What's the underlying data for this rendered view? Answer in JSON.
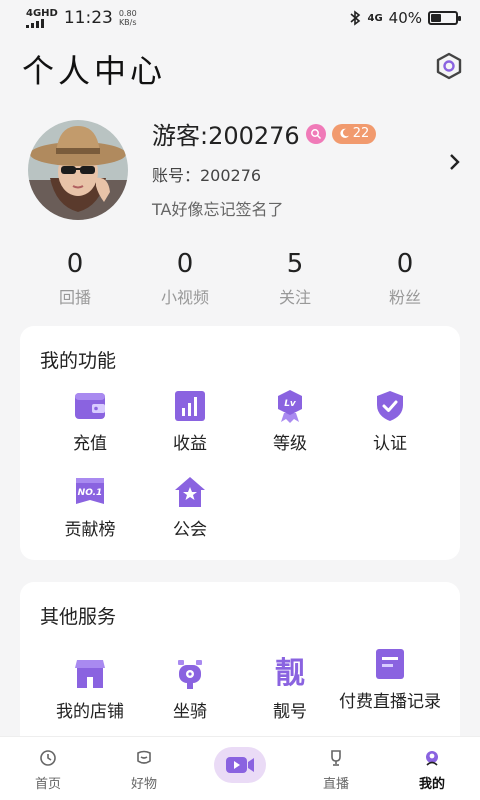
{
  "status_bar": {
    "network": "4GHD",
    "time": "11:23",
    "speed_value": "0.80",
    "speed_unit": "KB/s",
    "network_right": "4G",
    "battery": "40%",
    "battery_level": 0.4
  },
  "header": {
    "title": "个人中心",
    "settings_icon": "hexagon-settings-icon"
  },
  "profile": {
    "name": "游客:200276",
    "level": "22",
    "account": "账号：200276",
    "signature": "TA好像忘记签名了"
  },
  "stats": [
    {
      "value": "0",
      "label": "回播"
    },
    {
      "value": "0",
      "label": "小视频"
    },
    {
      "value": "5",
      "label": "关注"
    },
    {
      "value": "0",
      "label": "粉丝"
    }
  ],
  "functions": {
    "title": "我的功能",
    "items": [
      {
        "label": "充值",
        "icon": "wallet-icon"
      },
      {
        "label": "收益",
        "icon": "income-chart-icon"
      },
      {
        "label": "等级",
        "icon": "level-badge-icon"
      },
      {
        "label": "认证",
        "icon": "shield-check-icon"
      },
      {
        "label": "贡献榜",
        "icon": "ranking-no1-icon"
      },
      {
        "label": "公会",
        "icon": "guild-house-icon"
      }
    ]
  },
  "services": {
    "title": "其他服务",
    "items": [
      {
        "label": "我的店铺",
        "icon": "shop-icon"
      },
      {
        "label": "坐骑",
        "icon": "mount-scooter-icon"
      },
      {
        "label": "靓号",
        "icon": "pretty-number-icon",
        "glyph": "靓"
      },
      {
        "label": "付费直播记录",
        "icon": "paid-live-record-icon"
      }
    ]
  },
  "tab_bar": {
    "items": [
      {
        "label": "首页",
        "icon": "home-icon"
      },
      {
        "label": "好物",
        "icon": "goods-icon"
      },
      {
        "label": "",
        "icon": "live-camera-icon"
      },
      {
        "label": "直播",
        "icon": "trophy-icon"
      },
      {
        "label": "我的",
        "icon": "profile-icon"
      }
    ],
    "active": "我的"
  },
  "colors": {
    "accent": "#8a63e0",
    "badge_pink": "#f07ab8",
    "badge_orange": "#f19a6e",
    "live_button_bg": "#eadbf6"
  }
}
